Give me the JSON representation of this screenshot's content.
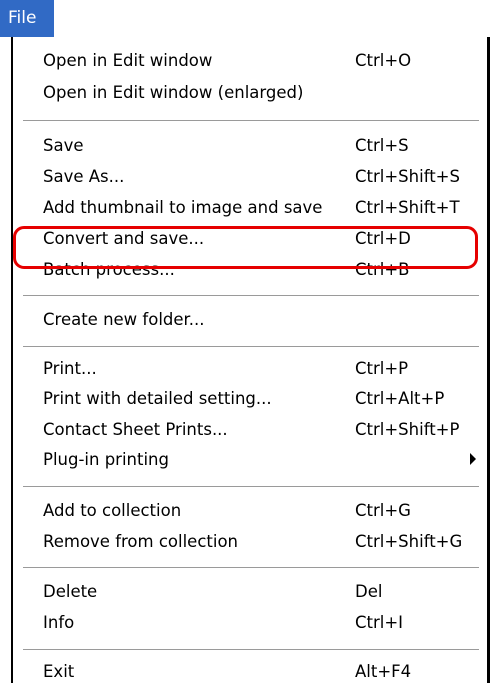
{
  "menu": {
    "title": "File"
  },
  "items": {
    "open_edit": {
      "label": "Open in Edit window",
      "shortcut": "Ctrl+O"
    },
    "open_edit_enlarged": {
      "label": "Open in Edit window (enlarged)",
      "shortcut": ""
    },
    "save": {
      "label": "Save",
      "shortcut": "Ctrl+S"
    },
    "save_as": {
      "label": "Save As...",
      "shortcut": "Ctrl+Shift+S"
    },
    "add_thumbnail": {
      "label": "Add thumbnail to image and save",
      "shortcut": "Ctrl+Shift+T"
    },
    "convert_save": {
      "label": "Convert and save...",
      "shortcut": "Ctrl+D"
    },
    "batch_process": {
      "label": "Batch process...",
      "shortcut": "Ctrl+B"
    },
    "create_folder": {
      "label": "Create new folder...",
      "shortcut": ""
    },
    "print": {
      "label": "Print...",
      "shortcut": "Ctrl+P"
    },
    "print_detailed": {
      "label": "Print with detailed setting...",
      "shortcut": "Ctrl+Alt+P"
    },
    "contact_sheet": {
      "label": "Contact Sheet Prints...",
      "shortcut": "Ctrl+Shift+P"
    },
    "plugin_printing": {
      "label": "Plug-in printing",
      "shortcut": ""
    },
    "add_collection": {
      "label": "Add to collection",
      "shortcut": "Ctrl+G"
    },
    "remove_collection": {
      "label": "Remove from collection",
      "shortcut": "Ctrl+Shift+G"
    },
    "delete": {
      "label": "Delete",
      "shortcut": "Del"
    },
    "info": {
      "label": "Info",
      "shortcut": "Ctrl+I"
    },
    "exit": {
      "label": "Exit",
      "shortcut": "Alt+F4"
    }
  },
  "highlight": {
    "item": "convert_save",
    "color": "#e60000"
  },
  "colors": {
    "menu_title_bg": "#316ac5",
    "menu_title_text": "#ffffff",
    "separator": "#9a9a9a"
  }
}
